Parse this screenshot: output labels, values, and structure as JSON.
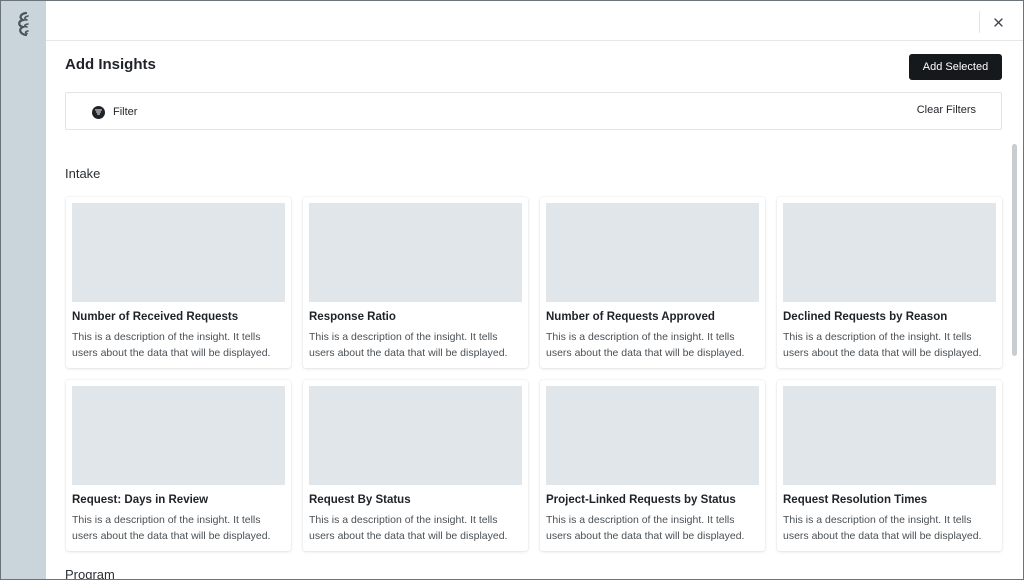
{
  "modal": {
    "title": "Add Insights",
    "add_selected_label": "Add Selected",
    "close_glyph": "×"
  },
  "filter": {
    "label": "Filter",
    "clear_label": "Clear Filters"
  },
  "sections": [
    {
      "title": "Intake",
      "cards": [
        {
          "title": "Number of Received Requests",
          "description": "This is a description of the insight. It tells users about the data that will be displayed."
        },
        {
          "title": "Response Ratio",
          "description": "This is a description of the insight. It tells users about the data that will be displayed."
        },
        {
          "title": "Number of Requests Approved",
          "description": "This is a description of the insight. It tells users about the data that will be displayed."
        },
        {
          "title": "Declined Requests by Reason",
          "description": "This is a description of the insight. It tells users about the data that will be displayed."
        },
        {
          "title": "Request: Days in Review",
          "description": "This is a description of the insight. It tells users about the data that will be displayed."
        },
        {
          "title": "Request By Status",
          "description": "This is a description of the insight. It tells users about the data that will be displayed."
        },
        {
          "title": "Project-Linked Requests by Status",
          "description": "This is a description of the insight. It tells users about the data that will be displayed."
        },
        {
          "title": "Request Resolution Times",
          "description": "This is a description of the insight. It tells users about the data that will be displayed."
        }
      ]
    },
    {
      "title": "Program",
      "cards": []
    }
  ],
  "icons": {
    "logo": "logo-icon",
    "close": "close-icon",
    "filter": "filter-icon"
  },
  "colors": {
    "rail": "#c9d5db",
    "primary_button": "#15191c",
    "thumbnail": "#e0e6ea"
  }
}
